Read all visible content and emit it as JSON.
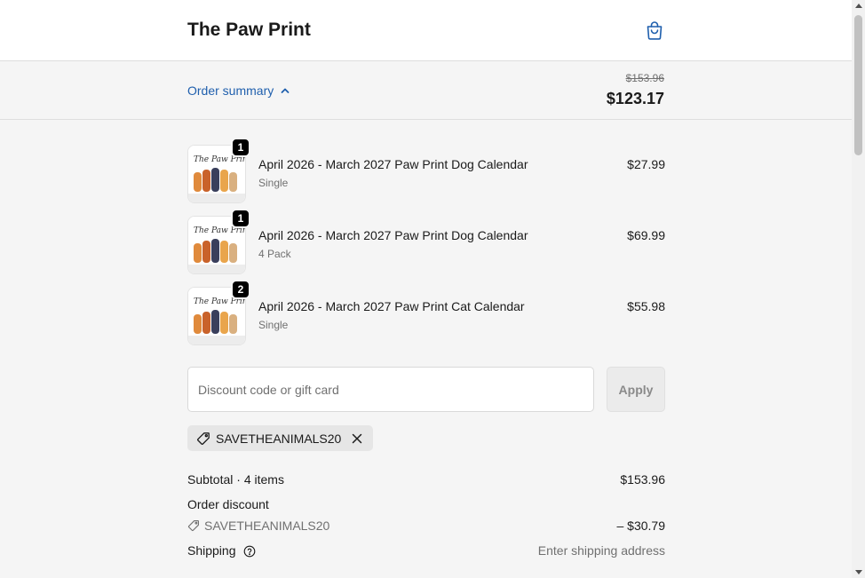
{
  "header": {
    "store_name": "The Paw Print",
    "cart_icon": "shopping-bag-icon"
  },
  "summary": {
    "toggle_label": "Order summary",
    "toggle_icon": "chevron-up-icon",
    "original_total": "$153.96",
    "total": "$123.17"
  },
  "items": [
    {
      "quantity": "1",
      "title": "April 2026 - March 2027 Paw Print Dog Calendar",
      "variant": "Single",
      "price": "$27.99"
    },
    {
      "quantity": "1",
      "title": "April 2026 - March 2027 Paw Print Dog Calendar",
      "variant": "4 Pack",
      "price": "$69.99"
    },
    {
      "quantity": "2",
      "title": "April 2026 - March 2027 Paw Print Cat Calendar",
      "variant": "Single",
      "price": "$55.98"
    }
  ],
  "discount": {
    "placeholder": "Discount code or gift card",
    "apply_label": "Apply",
    "applied_code": "SAVETHEANIMALS20"
  },
  "totals": {
    "subtotal_label": "Subtotal · 4 items",
    "subtotal_value": "$153.96",
    "order_discount_label": "Order discount",
    "discount_code": "SAVETHEANIMALS20",
    "discount_value": "– $30.79",
    "shipping_label": "Shipping",
    "shipping_value": "Enter shipping address"
  },
  "colors": {
    "link": "#1f5fad",
    "background": "#f5f5f5",
    "header_bg": "#ffffff"
  }
}
